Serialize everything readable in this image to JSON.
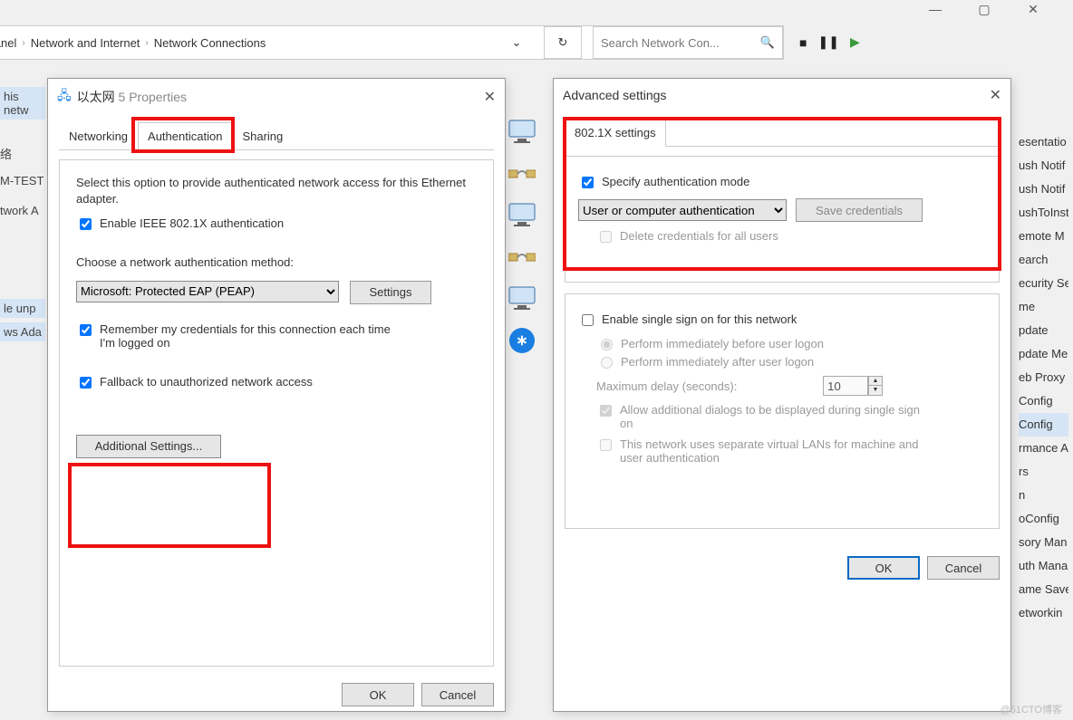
{
  "breadcrumb": {
    "items": [
      "ontrol Panel",
      "Network and Internet",
      "Network Connections"
    ]
  },
  "search": {
    "placeholder": "Search Network Con..."
  },
  "left_fragments": {
    "this_net": "his netw",
    "lu": "络",
    "mtest": "M-TEST",
    "twork": "twork A",
    "le_unp": "le unp",
    "ws_ada": "ws Ada"
  },
  "right_fragments": [
    "esentatio",
    "ush Notif",
    "ush Notif",
    "ushToInst",
    "emote M",
    "earch",
    "ecurity Se",
    "me",
    "pdate",
    "pdate Me",
    "eb Proxy",
    "Config",
    "Config",
    "rmance Ac",
    "rs",
    "n",
    "oConfig",
    "sory Man",
    "uth Mana",
    "ame Save",
    "etworkin"
  ],
  "properties_dialog": {
    "title_prefix": "以太网",
    "title_suffix": "5 Properties",
    "tabs": {
      "networking": "Networking",
      "auth": "Authentication",
      "sharing": "Sharing"
    },
    "intro": "Select this option to provide authenticated network access for this Ethernet adapter.",
    "enable_8021x": "Enable IEEE 802.1X authentication",
    "choose_method": "Choose a network authentication method:",
    "method_value": "Microsoft: Protected EAP (PEAP)",
    "settings_btn": "Settings",
    "remember": "Remember my credentials for this connection each time I'm logged on",
    "fallback": "Fallback to unauthorized network access",
    "additional": "Additional Settings...",
    "ok": "OK",
    "cancel": "Cancel"
  },
  "advanced_dialog": {
    "title": "Advanced settings",
    "settings_tab": "802.1X settings",
    "specify": "Specify authentication mode",
    "mode_value": "User or computer authentication",
    "save_creds": "Save credentials",
    "delete_creds": "Delete credentials for all users",
    "enable_sso": "Enable single sign on for this network",
    "before_logon": "Perform immediately before user logon",
    "after_logon": "Perform immediately after user logon",
    "max_delay": "Maximum delay (seconds):",
    "max_delay_val": "10",
    "allow_dialogs": "Allow additional dialogs to be displayed during single sign on",
    "vlan": "This network uses separate virtual LANs for machine and user authentication",
    "ok": "OK",
    "cancel": "Cancel"
  },
  "watermark": "@51CTO博客"
}
